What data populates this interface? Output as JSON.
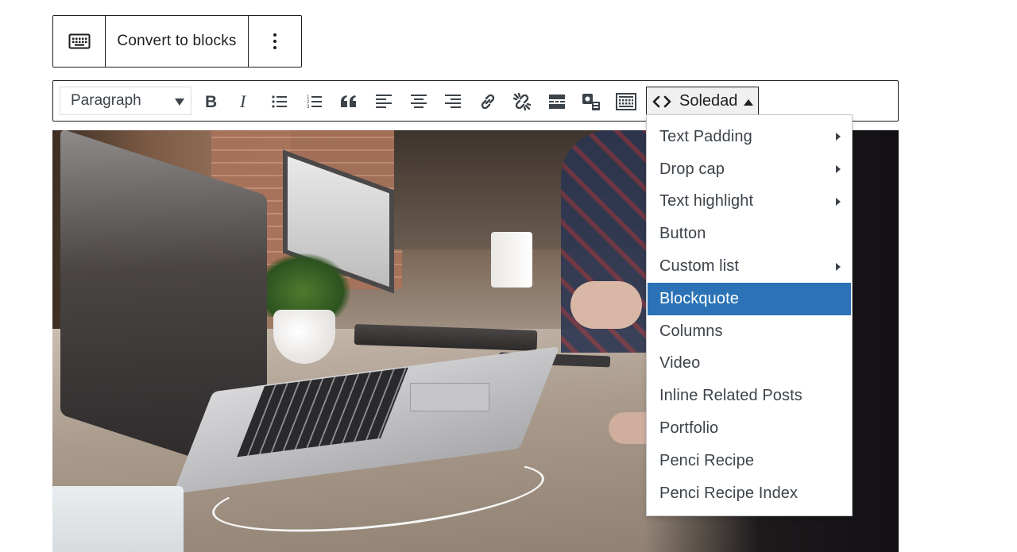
{
  "block_toolbar": {
    "keyboard_icon": "keyboard-icon",
    "convert_label": "Convert to blocks",
    "more_icon": "more-vertical-icon"
  },
  "editor_toolbar": {
    "format_select": {
      "selected": "Paragraph"
    },
    "buttons": [
      {
        "name": "bold",
        "icon": "bold-icon"
      },
      {
        "name": "italic",
        "icon": "italic-icon"
      },
      {
        "name": "bulleted-list",
        "icon": "bulleted-list-icon"
      },
      {
        "name": "numbered-list",
        "icon": "numbered-list-icon"
      },
      {
        "name": "blockquote",
        "icon": "quote-icon"
      },
      {
        "name": "align-left",
        "icon": "align-left-icon"
      },
      {
        "name": "align-center",
        "icon": "align-center-icon"
      },
      {
        "name": "align-right",
        "icon": "align-right-icon"
      },
      {
        "name": "insert-link",
        "icon": "link-icon"
      },
      {
        "name": "remove-link",
        "icon": "unlink-icon"
      },
      {
        "name": "read-more",
        "icon": "read-more-icon"
      },
      {
        "name": "insert-shortcode",
        "icon": "shortcode-icon"
      },
      {
        "name": "toolbar-toggle",
        "icon": "keyboard-toggle-icon"
      }
    ],
    "soledad": {
      "label": "Soledad",
      "icon": "code-icon"
    }
  },
  "soledad_menu": {
    "accent_color": "#2b73b6",
    "items": [
      {
        "label": "Text Padding",
        "has_submenu": true,
        "active": false
      },
      {
        "label": "Drop cap",
        "has_submenu": true,
        "active": false
      },
      {
        "label": "Text highlight",
        "has_submenu": true,
        "active": false
      },
      {
        "label": "Button",
        "has_submenu": false,
        "active": false
      },
      {
        "label": "Custom list",
        "has_submenu": true,
        "active": false
      },
      {
        "label": "Blockquote",
        "has_submenu": false,
        "active": true
      },
      {
        "label": "Columns",
        "has_submenu": false,
        "active": false
      },
      {
        "label": "Video",
        "has_submenu": false,
        "active": false
      },
      {
        "label": "Inline Related Posts",
        "has_submenu": false,
        "active": false
      },
      {
        "label": "Portfolio",
        "has_submenu": false,
        "active": false
      },
      {
        "label": "Penci Recipe",
        "has_submenu": false,
        "active": false
      },
      {
        "label": "Penci Recipe Index",
        "has_submenu": false,
        "active": false
      }
    ]
  }
}
